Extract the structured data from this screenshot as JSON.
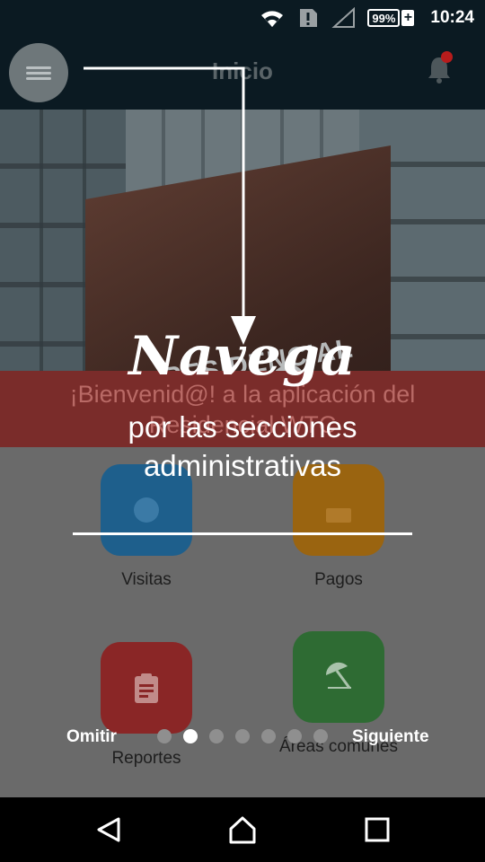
{
  "status_bar": {
    "battery": "99%",
    "battery_plus": "+",
    "time": "10:24"
  },
  "app_bar": {
    "title": "Inicio",
    "notification_count_color": "#b71c1c"
  },
  "hero": {
    "welcome": "¡Bienvenid@!  a la aplicación del Residencial WTC",
    "sign_small": "RESIDENCIAL",
    "sign_large": "WTC"
  },
  "tiles": [
    {
      "label": "Visitas",
      "color": "#1e5f8c",
      "icon": "visitor-icon"
    },
    {
      "label": "Pagos",
      "color": "#9a6410",
      "icon": "payment-icon"
    },
    {
      "label": "Reportes",
      "color": "#8a2626",
      "icon": "clipboard-icon"
    },
    {
      "label": "Áreas comúnes",
      "color": "#2e6b33",
      "icon": "beach-umbrella-icon"
    }
  ],
  "tutorial": {
    "title": "Navega",
    "subtitle": "por las secciones administrativas",
    "skip_label": "Omitir",
    "next_label": "Siguiente",
    "total_pages": 7,
    "current_page": 2
  },
  "nav": {
    "back": "back-icon",
    "home": "home-icon",
    "recent": "recent-apps-icon"
  }
}
